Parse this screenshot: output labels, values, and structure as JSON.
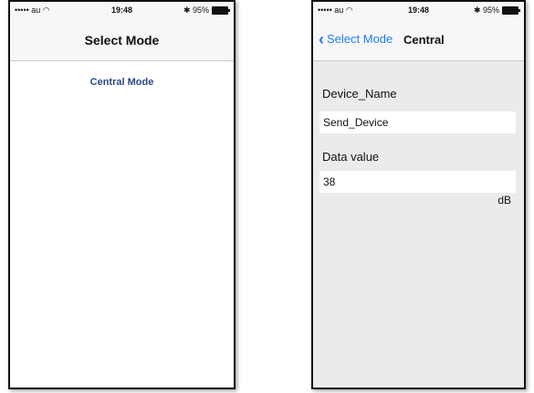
{
  "left_screen": {
    "status": {
      "carrier": "••••• au ◠",
      "time": "19:48",
      "battery": "✱ 95%"
    },
    "nav_title": "Select Mode",
    "central_mode_label": "Central Mode"
  },
  "right_screen": {
    "status": {
      "carrier": "••••• au ◠",
      "time": "19:48",
      "battery": "✱ 95%"
    },
    "back_label": "Select Mode",
    "back_chevron": "‹",
    "nav_title": "Central",
    "device_name_label": "Device_Name",
    "device_name_value": "Send_Device",
    "data_value_label": "Data value",
    "data_value": "38",
    "unit": "dB"
  },
  "colors": {
    "link": "#2b4a86",
    "ios_blue": "#1f7bf5",
    "content_bg": "#ebebeb"
  },
  "icons": [
    "signal-icon",
    "wifi-icon",
    "bluetooth-icon",
    "battery-icon",
    "back-chevron-icon"
  ]
}
